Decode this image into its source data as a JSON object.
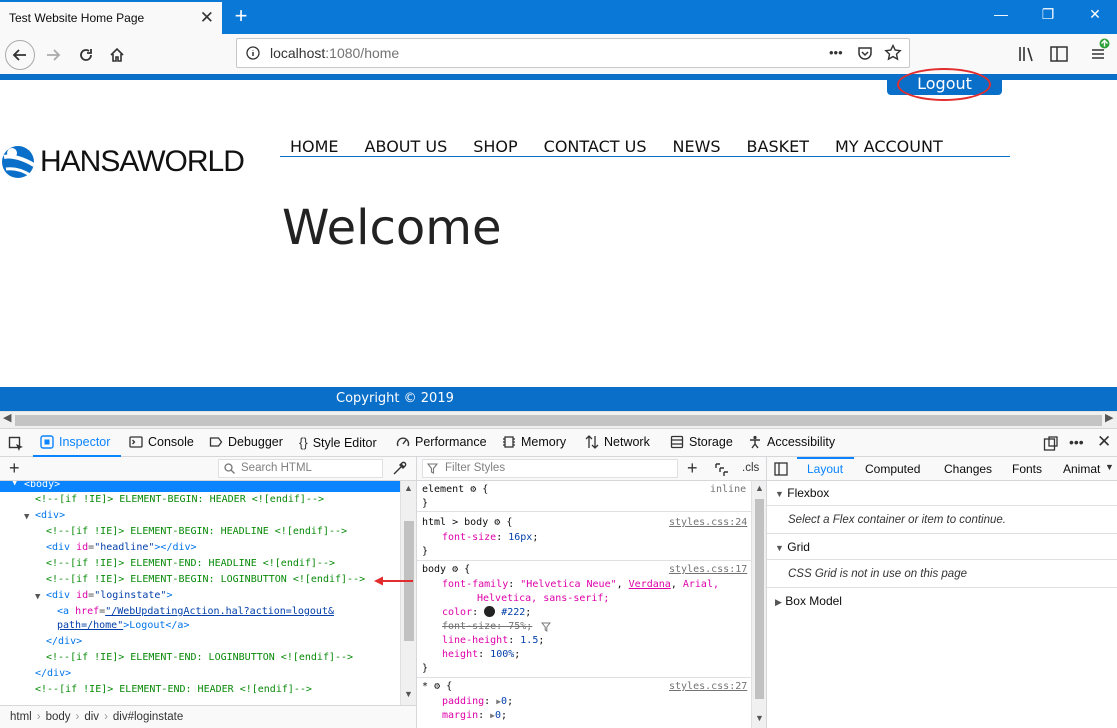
{
  "browser": {
    "tab_title": "Test Website Home Page",
    "tab_close": "✕",
    "new_tab": "+",
    "window_controls": {
      "minimize": "—",
      "restore": "❐",
      "close": "✕"
    },
    "url_host": "localhost",
    "url_rest": ":1080/home",
    "page_actions": "•••"
  },
  "page": {
    "logout_label": "Logout",
    "logo_text": "HANSAWORLD",
    "menu": [
      "HOME",
      "ABOUT US",
      "SHOP",
      "CONTACT US",
      "NEWS",
      "BASKET",
      "MY ACCOUNT"
    ],
    "welcome": "Welcome",
    "footer": "Copyright © 2019"
  },
  "devtools": {
    "tabs": [
      "Inspector",
      "Console",
      "Debugger",
      "Style Editor",
      "Performance",
      "Memory",
      "Network",
      "Storage",
      "Accessibility"
    ],
    "search_html_placeholder": "Search HTML",
    "filter_styles_placeholder": "Filter Styles",
    "cls_label": ".cls",
    "markup": {
      "body_tag": "<body>",
      "l1": "<!--[if !IE]> ELEMENT-BEGIN: HEADER <![endif]-->",
      "l2": "<div>",
      "l3": "<!--[if !IE]> ELEMENT-BEGIN: HEADLINE <![endif]-->",
      "l4_open": "<div ",
      "l4_attr": "id",
      "l4_val": "\"headline\"",
      "l4_close": "></div>",
      "l5": "<!--[if !IE]> ELEMENT-END: HEADLINE <![endif]-->",
      "l6": "<!--[if !IE]> ELEMENT-BEGIN: LOGINBUTTON <![endif]-->",
      "l7_open": "<div ",
      "l7_attr": "id",
      "l7_val": "\"loginstate\"",
      "l7_close": ">",
      "l8_open": "<a ",
      "l8_attr": "href",
      "l8_val": "\"/WebUpdatingAction.hal?action=logout&",
      "l9_val": "path=/home\"",
      "l9_text": ">Logout</a>",
      "l10": "</div>",
      "l11": "<!--[if !IE]> ELEMENT-END: LOGINBUTTON <![endif]-->",
      "l12": "</div>",
      "l13": "<!--[if !IE]> ELEMENT-END: HEADER <![endif]-->"
    },
    "breadcrumbs": [
      "html",
      "body",
      "div",
      "div#loginstate"
    ],
    "rules": {
      "r1_sel": "element",
      "r1_src": "inline",
      "r2_sel": "html > body",
      "r2_src": "styles.css:24",
      "r2_p1n": "font-size",
      "r2_p1v": "16px",
      "r3_sel": "body",
      "r3_src": "styles.css:17",
      "r3_ffn": "font-family",
      "r3_ff1": "\"Helvetica Neue\"",
      "r3_ff2": "Verdana",
      "r3_ff3": "Arial,",
      "r3_ff4": "Helvetica, sans-serif;",
      "r3_coln": "color",
      "r3_colv": "#222",
      "r3_fsn": "font-size: 75%;",
      "r3_lhn": "line-height",
      "r3_lhv": "1.5",
      "r3_hn": "height",
      "r3_hv": "100%",
      "r4_sel": "*",
      "r4_src": "styles.css:27",
      "r4_pn": "padding",
      "r4_pv": "0",
      "r4_mn": "margin",
      "r4_mv": "0"
    },
    "layout_tabs": [
      "Layout",
      "Computed",
      "Changes",
      "Fonts",
      "Animat"
    ],
    "flexbox_label": "Flexbox",
    "flexbox_note": "Select a Flex container or item to continue.",
    "grid_label": "Grid",
    "grid_note": "CSS Grid is not in use on this page",
    "boxmodel_label": "Box Model"
  }
}
